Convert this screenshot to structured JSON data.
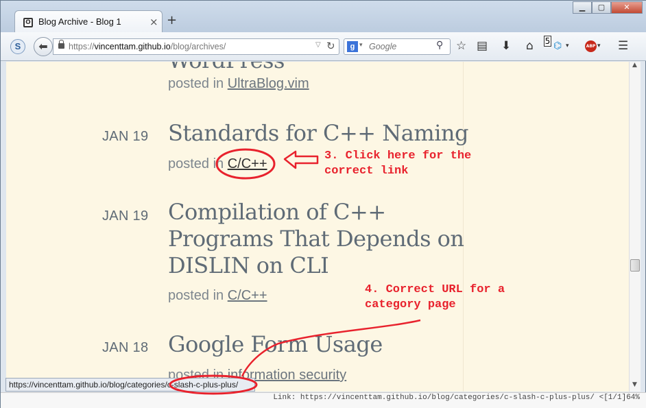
{
  "tab": {
    "title": "Blog Archive - Blog 1",
    "close": "×",
    "new_tab": "+"
  },
  "window_buttons": {
    "minimize": "▁",
    "maximize": "▢",
    "close": "✕"
  },
  "navbar": {
    "s_button": "S",
    "back": "⬅",
    "url_prefix": "https://",
    "url_host": "vincenttam.github.io",
    "url_path": "/blog/archives/",
    "search_engine": "g",
    "search_placeholder": "Google",
    "reader_badge": "5"
  },
  "posts": [
    {
      "title_fragment": "WordPress",
      "category": "UltraBlog.vim"
    },
    {
      "date": "JAN 19",
      "title": "Standards for C++ Naming",
      "category": "C/C++"
    },
    {
      "date": "JAN 19",
      "title_lines": [
        "Compilation of C++",
        "Programs That Depends on",
        "DISLIN on CLI"
      ],
      "category": "C/C++"
    },
    {
      "date": "JAN 18",
      "title": "Google Form Usage",
      "category": "information security"
    }
  ],
  "posted_in_label": "posted in",
  "annotations": {
    "step3": [
      "3. Click here for the",
      "correct link"
    ],
    "step4": [
      "4. Correct URL for a",
      "category page"
    ]
  },
  "status_link": "https://vincenttam.github.io/blog/categories/c-slash-c-plus-plus/",
  "statusline": "Link: https://vincenttam.github.io/blog/categories/c-slash-c-plus-plus/ <[1/1]64%",
  "colors": {
    "annotation": "#e8222d",
    "page_bg": "#fdf7e4",
    "title": "#5f6b76"
  }
}
